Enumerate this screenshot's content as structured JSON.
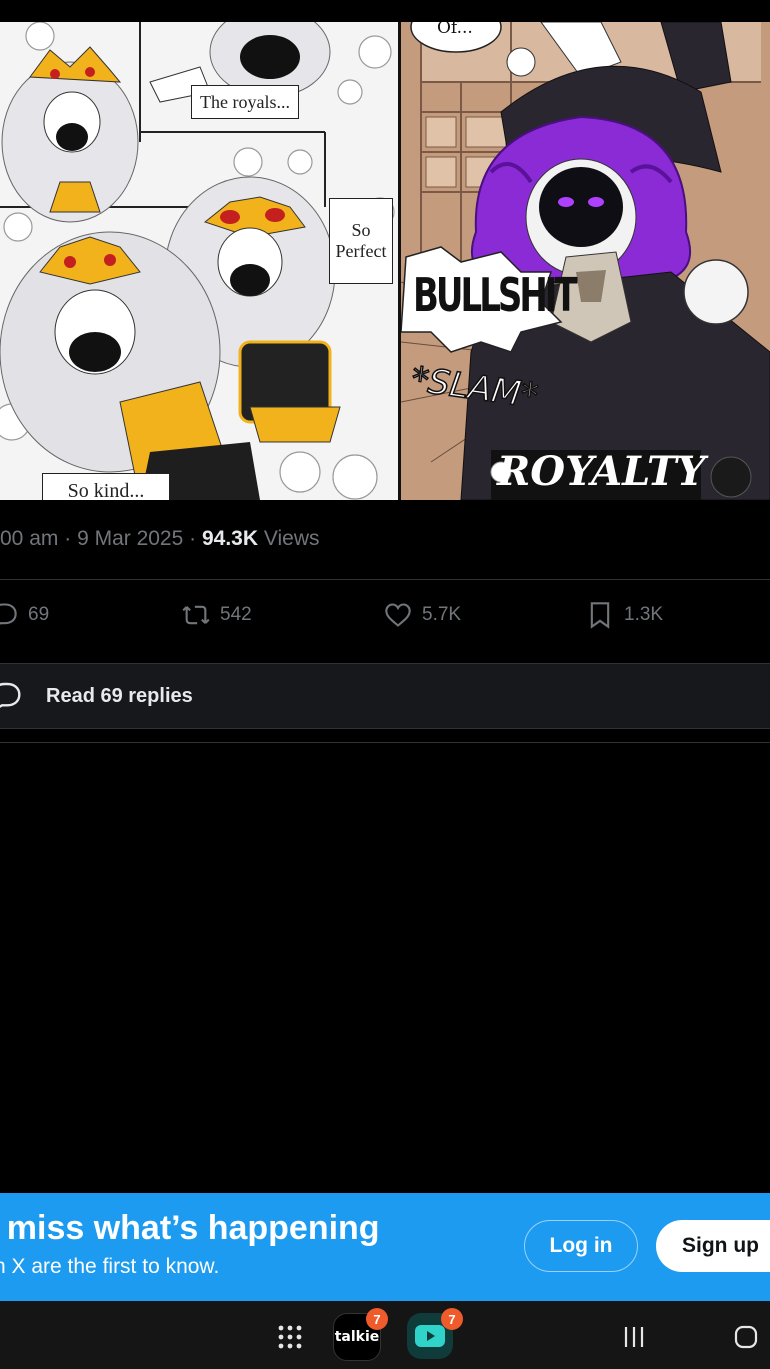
{
  "comic": {
    "left_captions": [
      "The royals...",
      "So Perfect",
      "So kind..."
    ],
    "right_bubble": "Of...",
    "right_shout": "BULLSHIT",
    "right_sfx": "*SLAM*",
    "right_title": "ROYALTY"
  },
  "tweet": {
    "time": "00 am",
    "date": "9 Mar 2025",
    "views_count": "94.3K",
    "views_label": "Views",
    "separator": "·"
  },
  "actions": {
    "replies": "69",
    "reposts": "542",
    "likes": "5.7K",
    "bookmarks": "1.3K"
  },
  "read_replies": "Read 69 replies",
  "banner": {
    "title": "t miss what’s happening",
    "subtitle": "n X are the first to know.",
    "login": "Log in",
    "signup": "Sign up",
    "color": "#1d9bf0"
  },
  "navbar": {
    "talkie_label": "talkie",
    "talkie_badge": "7",
    "youtube_badge": "7"
  }
}
